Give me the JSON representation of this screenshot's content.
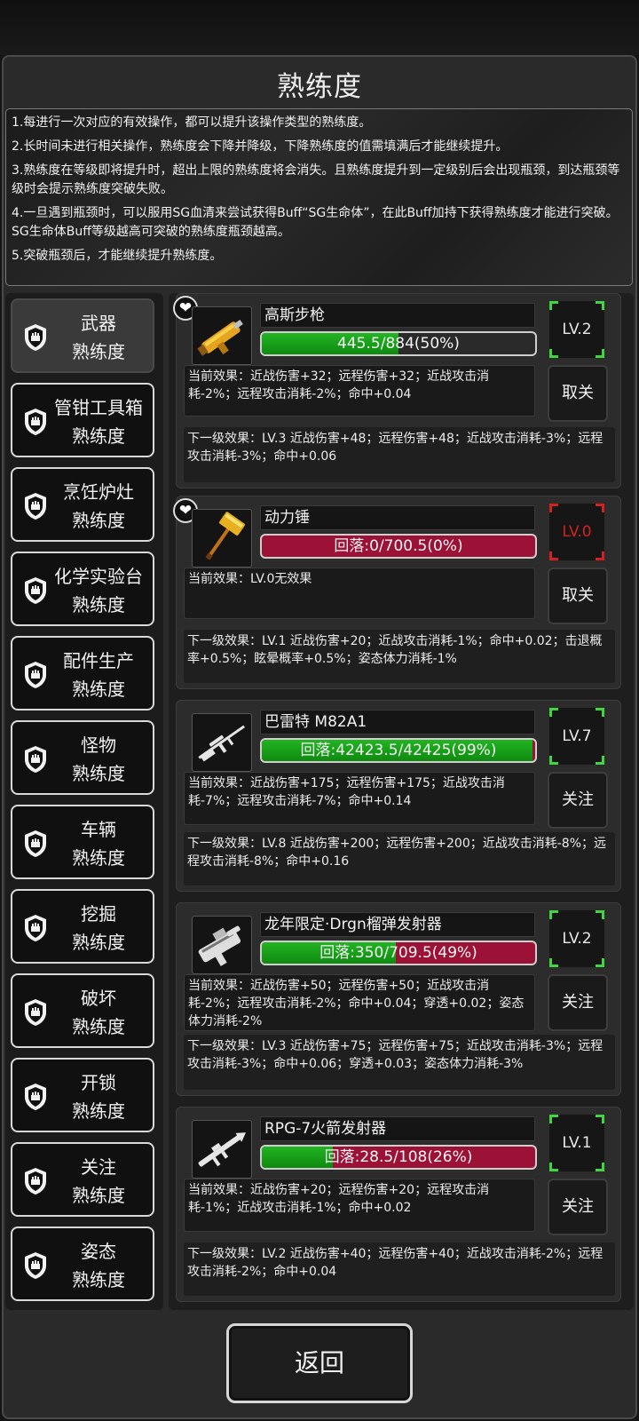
{
  "title": "熟练度",
  "rules": [
    "1.每进行一次对应的有效操作，都可以提升该操作类型的熟练度。",
    "2.长时间未进行相关操作，熟练度会下降并降级，下降熟练度的值需填满后才能继续提升。",
    "3.熟练度在等级即将提升时，超出上限的熟练度将会消失。且熟练度提升到一定级别后会出现瓶颈，到达瓶颈等级时会提示熟练度突破失败。",
    "4.一旦遇到瓶颈时，可以服用SG血清来尝试获得Buff“SG生命体”，在此Buff加持下获得熟练度才能进行突破。SG生命体Buff等级越高可突破的熟练度瓶颈越高。",
    "5.突破瓶颈后，才能继续提升熟练度。"
  ],
  "categories": [
    {
      "name": "武器",
      "suffix": "熟练度",
      "active": true
    },
    {
      "name": "管钳工具箱",
      "suffix": "熟练度"
    },
    {
      "name": "烹饪炉灶",
      "suffix": "熟练度"
    },
    {
      "name": "化学实验台",
      "suffix": "熟练度"
    },
    {
      "name": "配件生产",
      "suffix": "熟练度"
    },
    {
      "name": "怪物",
      "suffix": "熟练度"
    },
    {
      "name": "车辆",
      "suffix": "熟练度"
    },
    {
      "name": "挖掘",
      "suffix": "熟练度"
    },
    {
      "name": "破坏",
      "suffix": "熟练度"
    },
    {
      "name": "开锁",
      "suffix": "熟练度"
    },
    {
      "name": "关注",
      "suffix": "熟练度"
    },
    {
      "name": "姿态",
      "suffix": "熟练度"
    }
  ],
  "weapons": [
    {
      "name": "高斯步枪",
      "favorite": true,
      "bar_text": "445.5/884(50%)",
      "progress": 0.5,
      "bar_mode": "green",
      "level": "LV.2",
      "level_color": "#3fd63f",
      "current": "当前效果：近战伤害+32；远程伤害+32；近战攻击消耗-2%；远程攻击消耗-2%；命中+0.04",
      "button": "取关",
      "next": "下一级效果：LV.3 近战伤害+48；远程伤害+48；近战攻击消耗-3%；远程攻击消耗-3%；命中+0.06",
      "icon": "gauss-rifle-icon"
    },
    {
      "name": "动力锤",
      "favorite": true,
      "bar_text": "回落:0/700.5(0%)",
      "progress": 0.0,
      "bar_mode": "red",
      "level": "LV.0",
      "level_color": "#d42020",
      "current": "当前效果：LV.0无效果",
      "button": "取关",
      "next": "下一级效果：LV.1 近战伤害+20；近战攻击消耗-1%；命中+0.02；击退概率+0.5%；眩晕概率+0.5%；姿态体力消耗-1%",
      "icon": "power-hammer-icon"
    },
    {
      "name": "巴雷特 M82A1",
      "favorite": false,
      "bar_text": "回落:42423.5/42425(99%)",
      "progress": 0.99,
      "bar_mode": "mixed",
      "level": "LV.7",
      "level_color": "#3fd63f",
      "current": "当前效果：近战伤害+175；远程伤害+175；近战攻击消耗-7%；远程攻击消耗-7%；命中+0.14",
      "button": "关注",
      "next": "下一级效果：LV.8 近战伤害+200；远程伤害+200；近战攻击消耗-8%；远程攻击消耗-8%；命中+0.16",
      "icon": "sniper-rifle-icon"
    },
    {
      "name": "龙年限定·Drgn榴弹发射器",
      "favorite": false,
      "bar_text": "回落:350/709.5(49%)",
      "progress": 0.49,
      "bar_mode": "mixed",
      "level": "LV.2",
      "level_color": "#3fd63f",
      "current": "当前效果：近战伤害+50；远程伤害+50；近战攻击消耗-2%；远程攻击消耗-2%；命中+0.04；穿透+0.02；姿态体力消耗-2%",
      "button": "关注",
      "next": "下一级效果：LV.3 近战伤害+75；远程伤害+75；近战攻击消耗-3%；远程攻击消耗-3%；命中+0.06；穿透+0.03；姿态体力消耗-3%",
      "icon": "grenade-launcher-icon"
    },
    {
      "name": "RPG-7火箭发射器",
      "favorite": false,
      "bar_text": "回落:28.5/108(26%)",
      "progress": 0.26,
      "bar_mode": "mixed",
      "level": "LV.1",
      "level_color": "#3fd63f",
      "current": "当前效果：近战伤害+20；远程伤害+20；远程攻击消耗-1%；近战攻击消耗-1%；命中+0.02",
      "button": "关注",
      "next": "下一级效果：LV.2 近战伤害+40；远程伤害+40；近战攻击消耗-2%；远程攻击消耗-2%；命中+0.04",
      "icon": "rocket-launcher-icon"
    }
  ],
  "back_label": "返回"
}
